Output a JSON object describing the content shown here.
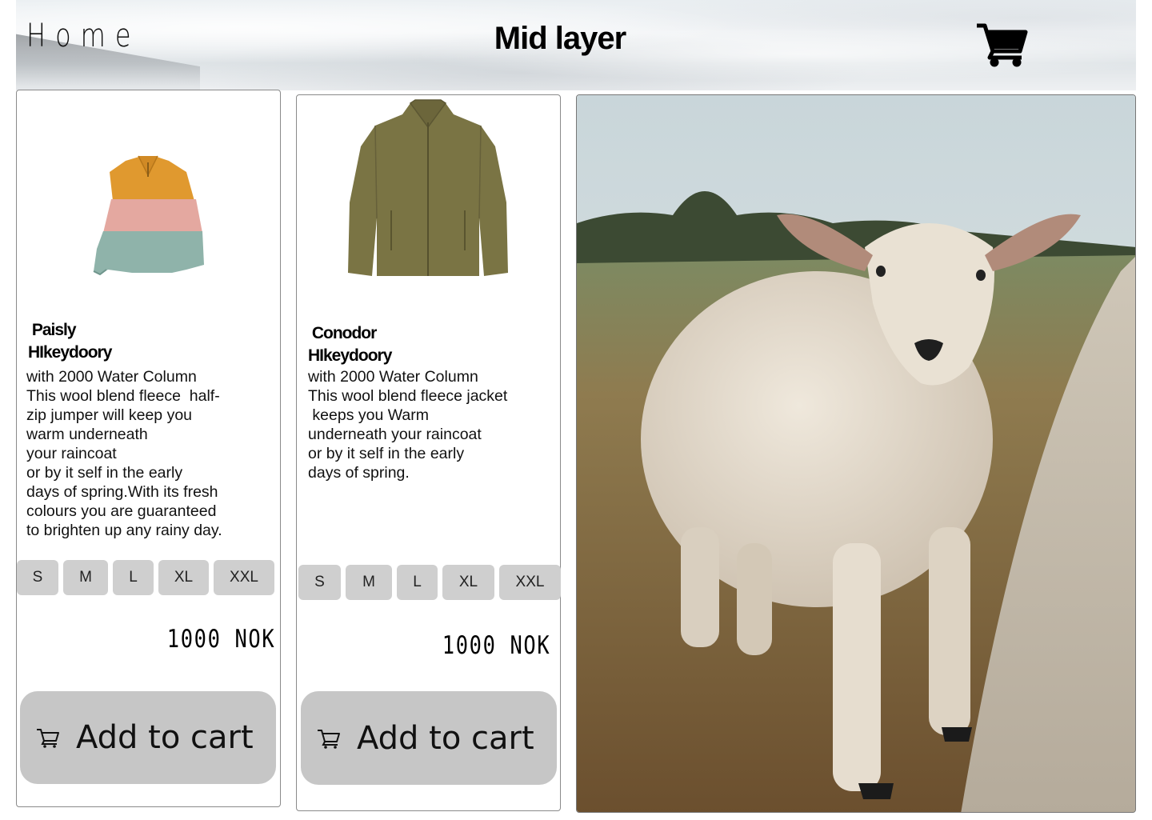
{
  "header": {
    "home_label": "Home",
    "title": "Mid layer",
    "cart_icon": "shopping-cart-icon"
  },
  "products": [
    {
      "name": " Paisly\nHIkeydoory",
      "description": "with 2000 Water Column\nThis wool blend fleece  half-\nzip jumper will keep you\nwarm underneath\nyour raincoat\nor by it self in the early\ndays of spring.With its fresh\ncolours you are guaranteed\nto brighten up any rainy day.",
      "sizes": [
        "S",
        "M",
        "L",
        "XL",
        "XXL"
      ],
      "price": "1000 NOK",
      "add_to_cart": "Add to cart"
    },
    {
      "name": " Conodor\nHIkeydoory",
      "description": "with 2000 Water Column\nThis wool blend fleece jacket\n keeps you Warm\nunderneath your raincoat\nor by it self in the early\ndays of spring.",
      "sizes": [
        "S",
        "M",
        "L",
        "XL",
        "XXL"
      ],
      "price": "1000 NOK",
      "add_to_cart": "Add to cart"
    }
  ],
  "colors": {
    "button_gray": "#c6c6c6",
    "size_gray": "#cfcfcf",
    "jumper_orange": "#e0992f",
    "jumper_pink": "#e4a8a0",
    "jumper_teal": "#8fb3aa",
    "jacket_olive": "#7a7444"
  }
}
